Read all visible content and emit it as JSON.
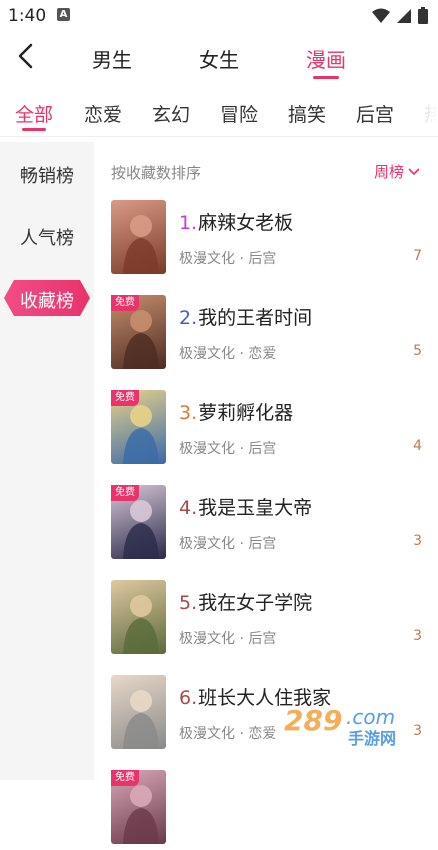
{
  "status_bar": {
    "time": "1:40",
    "a_icon": "A"
  },
  "top_tabs": [
    {
      "label": "男生",
      "active": false
    },
    {
      "label": "女生",
      "active": false
    },
    {
      "label": "漫画",
      "active": true
    }
  ],
  "categories": [
    "全部",
    "恋爱",
    "玄幻",
    "冒险",
    "搞笑",
    "后宫",
    "热"
  ],
  "sidebar": {
    "items": [
      "畅销榜",
      "人气榜",
      "收藏榜"
    ],
    "active": "收藏榜"
  },
  "list_header": {
    "sort_label": "按收藏数排序",
    "period": "周榜"
  },
  "items": [
    {
      "rank": "1.",
      "rank_color": "#c33ae0",
      "title": "麻辣女老板",
      "meta": "极漫文化 · 后宫",
      "count": "7",
      "free": false,
      "cover_colors": [
        "#7a3a2a",
        "#d99a86"
      ]
    },
    {
      "rank": "2.",
      "rank_color": "#4a5bc9",
      "title": "我的王者时间",
      "meta": "极漫文化 · 恋爱",
      "count": "5",
      "free": true,
      "cover_colors": [
        "#4d2c22",
        "#c78e6e"
      ]
    },
    {
      "rank": "3.",
      "rank_color": "#e07a2a",
      "title": "萝莉孵化器",
      "meta": "极漫文化 · 后宫",
      "count": "4",
      "free": true,
      "cover_colors": [
        "#3a6aa8",
        "#e8d28a"
      ]
    },
    {
      "rank": "4.",
      "rank_color": "#a84a4a",
      "title": "我是玉皇大帝",
      "meta": "极漫文化 · 后宫",
      "count": "3",
      "free": true,
      "cover_colors": [
        "#2a2a4a",
        "#d8c8d8"
      ]
    },
    {
      "rank": "5.",
      "rank_color": "#a84a4a",
      "title": "我在女子学院",
      "meta": "极漫文化 · 后宫",
      "count": "3",
      "free": false,
      "cover_colors": [
        "#5a6a3a",
        "#e0c8a0"
      ]
    },
    {
      "rank": "6.",
      "rank_color": "#a84a4a",
      "title": "班长大人住我家",
      "meta": "极漫文化 · 恋爱",
      "count": "3",
      "free": false,
      "cover_colors": [
        "#8a8a8a",
        "#e8d8c8"
      ]
    },
    {
      "rank": "",
      "rank_color": "#a84a4a",
      "title": "",
      "meta": "",
      "count": "",
      "free": true,
      "cover_colors": [
        "#6a3a4a",
        "#d8a8b8"
      ]
    }
  ],
  "free_badge": "免费",
  "watermark": {
    "brand": "289.com",
    "sub": "手游网"
  },
  "accent_color": "#e8336b"
}
